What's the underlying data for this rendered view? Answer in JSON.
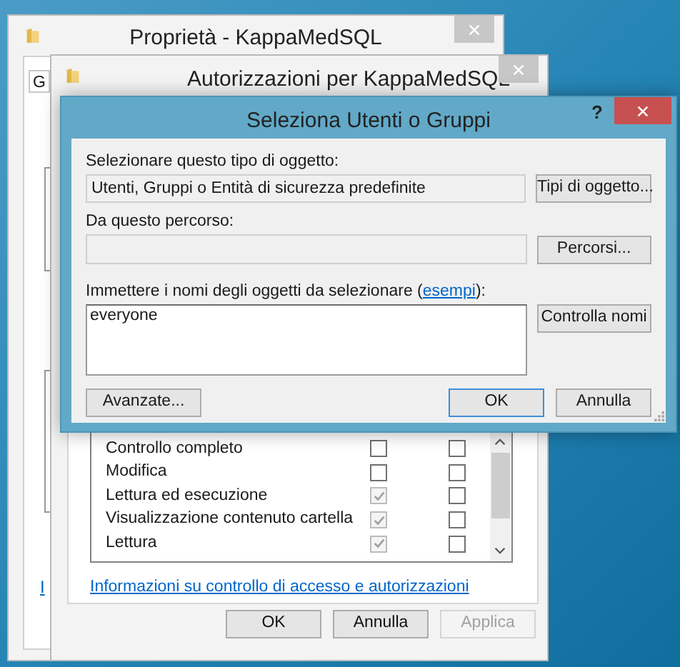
{
  "properties_window": {
    "title": "Proprietà - KappaMedSQL",
    "tab_label": "G",
    "link": "I"
  },
  "permissions_window": {
    "title": "Autorizzazioni per KappaMedSQL",
    "permissions": [
      {
        "name": "Controllo completo",
        "allow": false,
        "deny": false,
        "inherited": false
      },
      {
        "name": "Modifica",
        "allow": false,
        "deny": false,
        "inherited": false
      },
      {
        "name": "Lettura ed esecuzione",
        "allow": true,
        "deny": false,
        "inherited": true
      },
      {
        "name": "Visualizzazione contenuto cartella",
        "allow": true,
        "deny": false,
        "inherited": true
      },
      {
        "name": "Lettura",
        "allow": true,
        "deny": false,
        "inherited": true
      }
    ],
    "link": "Informazioni su controllo di accesso e autorizzazioni",
    "buttons": [
      {
        "label": "OK",
        "disabled": false
      },
      {
        "label": "Annulla",
        "disabled": false
      },
      {
        "label": "Applica",
        "disabled": true
      }
    ]
  },
  "select_dialog": {
    "title": "Seleziona Utenti o Gruppi",
    "help": "?",
    "object_type": {
      "label": "Selezionare questo tipo di oggetto:",
      "value": "Utenti, Gruppi o Entità di sicurezza predefinite",
      "button": "Tipi di oggetto..."
    },
    "location": {
      "label": "Da questo percorso:",
      "button": "Percorsi..."
    },
    "names": {
      "label_before": "Immettere i nomi degli oggetti da selezionare (",
      "link": "esempi",
      "label_after": "):",
      "value": "everyone",
      "button": "Controlla nomi"
    },
    "buttons": [
      {
        "label": "Avanzate...",
        "default": false
      },
      {
        "label": "OK",
        "default": true
      },
      {
        "label": "Annulla",
        "default": false
      }
    ]
  }
}
